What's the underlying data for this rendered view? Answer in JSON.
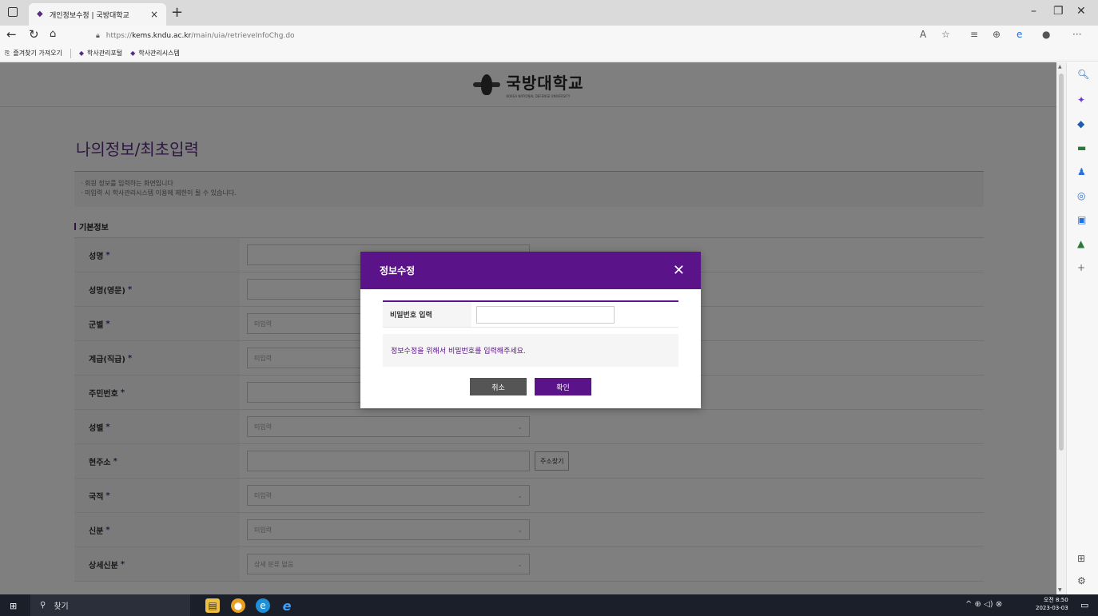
{
  "browser": {
    "tab_title": "개인정보수정 | 국방대학교",
    "url_prefix": "https://",
    "url_host": "kems.kndu.ac.kr",
    "url_path": "/main/uia/retrieveInfoChg.do",
    "bookmarks": [
      "즐겨찾기 가져오기",
      "학사관리포털",
      "학사관리시스템"
    ]
  },
  "header": {
    "logo_ko": "국방대학교",
    "logo_en": "KOREA NATIONAL DEFENSE UNIVERSITY"
  },
  "page": {
    "title": "나의정보/최초입력",
    "notice": [
      "· 회원 정보를 입력하는 화면입니다",
      "· 미입력 시 학사관리시스템 이용에 제한이 될 수 있습니다."
    ],
    "section": "기본정보"
  },
  "form": {
    "rows": [
      {
        "label": "성명",
        "req": "*",
        "type": "text",
        "value": ""
      },
      {
        "label": "성명(영문)",
        "req": "*",
        "type": "text",
        "value": ""
      },
      {
        "label": "군별",
        "req": "*",
        "type": "select",
        "value": "미입력"
      },
      {
        "label": "계급(직급)",
        "req": "*",
        "type": "select",
        "value": "미입력"
      },
      {
        "label": "주민번호",
        "req": "*",
        "type": "text",
        "value": ""
      },
      {
        "label": "성별",
        "req": "*",
        "type": "select",
        "value": "미입력"
      },
      {
        "label": "현주소",
        "req": "*",
        "type": "address",
        "value": "",
        "button": "주소찾기"
      },
      {
        "label": "국적",
        "req": "*",
        "type": "select",
        "value": "미입력"
      },
      {
        "label": "신분",
        "req": "*",
        "type": "select",
        "value": "미입력"
      },
      {
        "label": "상세신분",
        "req": "*",
        "type": "select",
        "value": "상세 분류 없음"
      }
    ]
  },
  "modal": {
    "title": "정보수정",
    "close": "✕",
    "field_label": "비밀번호 입력",
    "password_value": "",
    "message": "정보수정을 위해서 비밀번호를 입력해주세요.",
    "cancel": "취소",
    "confirm": "확인"
  },
  "taskbar": {
    "search": "찾기",
    "time": "오전 8:50",
    "date": "2023-03-03"
  },
  "colors": {
    "accent": "#5a1388",
    "title_purple": "#5a2d82"
  }
}
